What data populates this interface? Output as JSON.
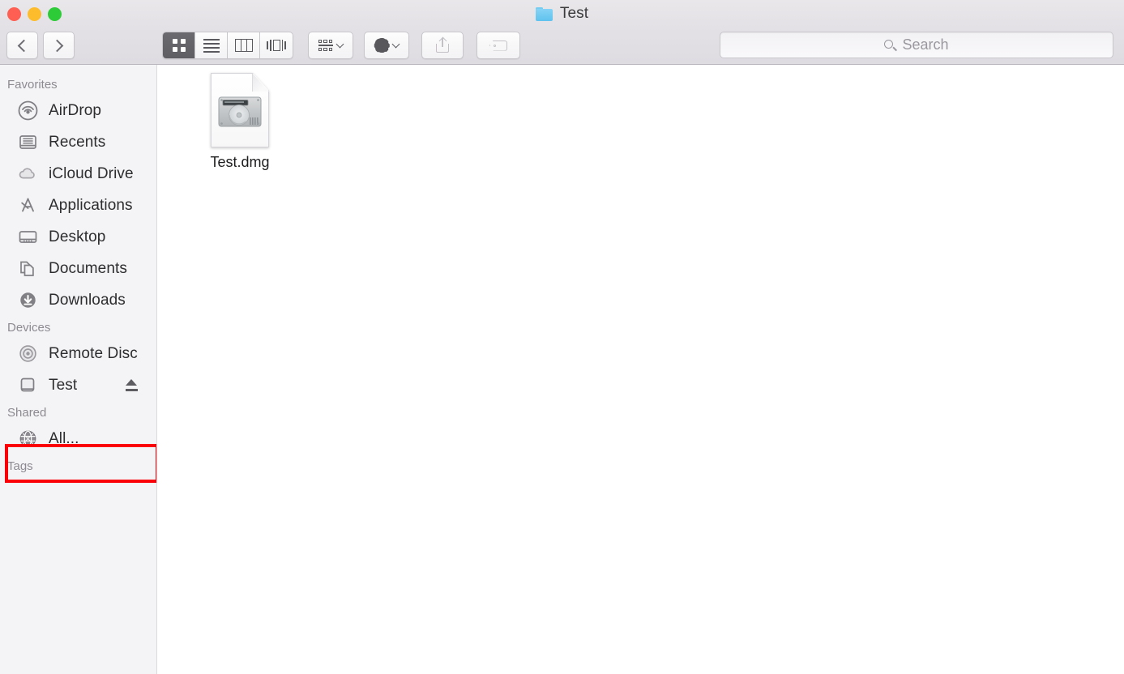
{
  "window": {
    "title": "Test",
    "title_icon": "folder-icon",
    "traffic_lights": [
      {
        "name": "close",
        "color": "#ff5f52"
      },
      {
        "name": "minimize",
        "color": "#fdbc2c"
      },
      {
        "name": "zoom",
        "color": "#2dcb38"
      }
    ]
  },
  "toolbar": {
    "back_icon": "chevron-left-icon",
    "forward_icon": "chevron-right-icon",
    "view_modes": [
      {
        "name": "icon-view",
        "icon": "grid-icon",
        "selected": true
      },
      {
        "name": "list-view",
        "icon": "list-icon",
        "selected": false
      },
      {
        "name": "column-view",
        "icon": "columns-icon",
        "selected": false
      },
      {
        "name": "gallery-view",
        "icon": "coverflow-icon",
        "selected": false
      }
    ],
    "arrange_icon": "arrange-grid-icon",
    "action_icon": "gear-icon",
    "share_icon": "share-icon",
    "tag_icon": "tag-icon",
    "dropdown_icon": "chevron-down-icon"
  },
  "search": {
    "placeholder": "Search",
    "value": "",
    "icon": "search-icon"
  },
  "sidebar": {
    "sections": [
      {
        "title": "Favorites",
        "items": [
          {
            "label": "AirDrop",
            "icon": "airdrop-icon",
            "eject": false
          },
          {
            "label": "Recents",
            "icon": "recents-icon",
            "eject": false
          },
          {
            "label": "iCloud Drive",
            "icon": "cloud-icon",
            "eject": false
          },
          {
            "label": "Applications",
            "icon": "applications-icon",
            "eject": false
          },
          {
            "label": "Desktop",
            "icon": "desktop-icon",
            "eject": false
          },
          {
            "label": "Documents",
            "icon": "documents-icon",
            "eject": false
          },
          {
            "label": "Downloads",
            "icon": "downloads-icon",
            "eject": false
          }
        ]
      },
      {
        "title": "Devices",
        "items": [
          {
            "label": "Remote Disc",
            "icon": "optical-disc-icon",
            "eject": false
          },
          {
            "label": "Test",
            "icon": "external-drive-icon",
            "eject": true,
            "highlighted": true
          }
        ]
      },
      {
        "title": "Shared",
        "items": [
          {
            "label": "All...",
            "icon": "network-globe-icon",
            "eject": false
          }
        ]
      },
      {
        "title": "Tags",
        "items": []
      }
    ],
    "highlight_color": "#fb0007"
  },
  "content": {
    "files": [
      {
        "name": "Test.dmg",
        "icon": "disk-image-document-icon",
        "selected": false
      }
    ]
  }
}
